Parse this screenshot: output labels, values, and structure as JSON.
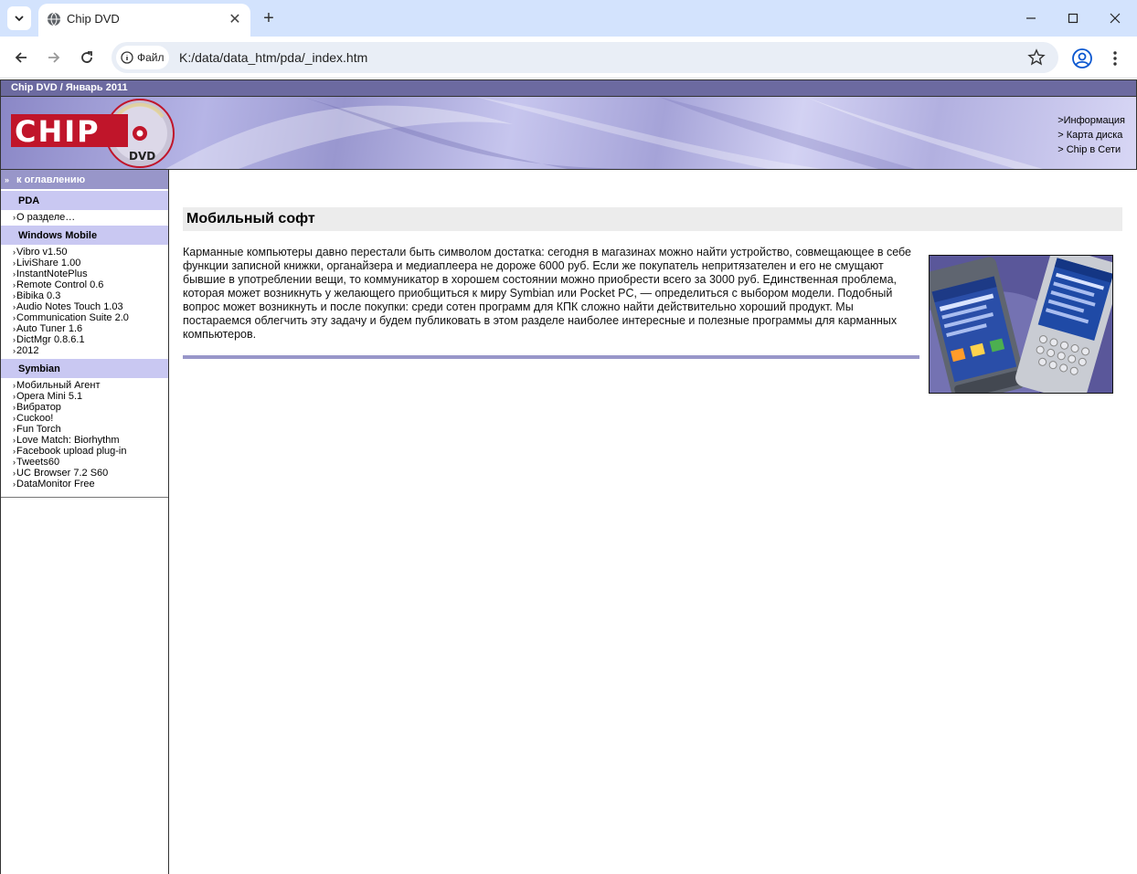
{
  "browser": {
    "tab_title": "Chip DVD",
    "site_chip": "Файл",
    "url": "K:/data/data_htm/pda/_index.htm"
  },
  "site": {
    "top_bar": "Chip DVD / Январь 2011",
    "logo_text": "CHIP",
    "logo_sub": "DVD",
    "banner_links": [
      ">Информация",
      "> Карта диска",
      "> Chip в Сети"
    ]
  },
  "sidebar": {
    "toc": "к оглавлению",
    "sections": [
      {
        "title": "PDA",
        "items": [
          "О разделе…"
        ]
      },
      {
        "title": "Windows Mobile",
        "items": [
          "Vibro v1.50",
          "LiviShare 1.00",
          "InstantNotePlus",
          "Remote Control 0.6",
          "Bibika 0.3",
          "Audio Notes Touch 1.03",
          "Communication Suite 2.0",
          "Auto Tuner 1.6",
          "DictMgr 0.8.6.1",
          "2012"
        ]
      },
      {
        "title": "Symbian",
        "items": [
          "Мобильный Агент",
          "Opera Mini 5.1",
          "Вибратор",
          "Cuckoo!",
          "Fun Torch",
          "Love Match: Biorhythm",
          "Facebook upload plug-in",
          "Tweets60",
          "UC Browser 7.2 S60",
          "DataMonitor Free"
        ]
      }
    ]
  },
  "main": {
    "title": "Мобильный софт",
    "intro": "Карманные компьютеры давно перестали быть символом достатка: сегодня в магазинах можно найти устройство, совмещающее в себе функции записной книжки, органайзера и медиаплеера не дороже 6000 руб. Если же покупатель непритязателен и его не смущают бывшие в употреблении вещи, то коммуникатор в хорошем состоянии можно приобрести всего за 3000 руб. Единственная проблема, которая может возникнуть у желающего приобщиться к миру Symbian или Pocket PC, — определиться с выбором модели. Подобный вопрос может возникнуть и после покупки: среди сотен программ для КПК сложно найти действительно хороший продукт. Мы постараемся облегчить эту задачу и будем публиковать в этом разделе наиболее интересные и полезные программы для карманных компьютеров."
  }
}
